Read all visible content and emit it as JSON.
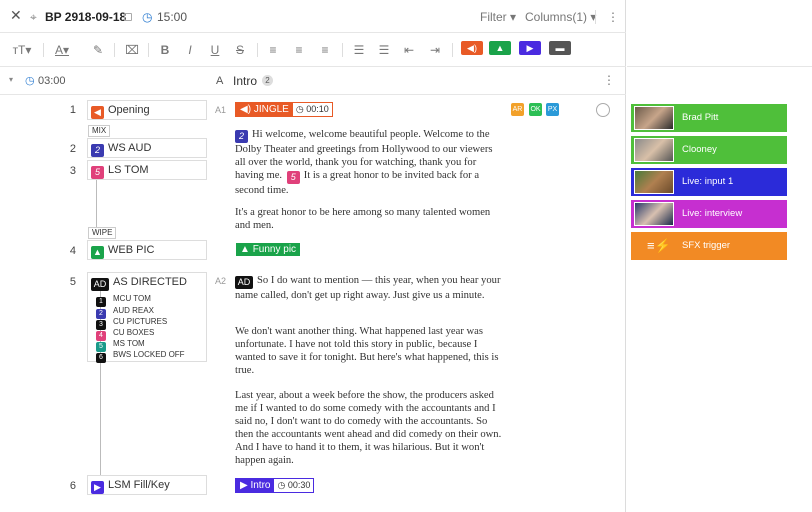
{
  "header": {
    "title": "BP 2918-09-18",
    "time": "15:00",
    "filter_label": "Filter",
    "columns_label": "Columns(1)"
  },
  "toolbar": {
    "buttons": [
      {
        "name": "text-size",
        "color": "#777"
      },
      {
        "name": "text-color",
        "color": "#777"
      },
      {
        "name": "highlight",
        "color": "#777"
      },
      {
        "name": "clear-format",
        "color": "#777"
      }
    ],
    "media_colors": {
      "audio": "#e85a26",
      "image": "#1aa34a",
      "video": "#4a2be0",
      "camera": "#555555"
    }
  },
  "segment": {
    "duration": "03:00",
    "column": "A",
    "name": "Intro",
    "count": "2"
  },
  "cues": {
    "r1": {
      "num": "1",
      "label": "Opening"
    },
    "mix": "MIX",
    "r2": {
      "num": "2",
      "label": "WS AUD",
      "icon_num": "2"
    },
    "r3": {
      "num": "3",
      "label": "LS TOM",
      "icon_num": "5"
    },
    "wipe": "WIPE",
    "r4": {
      "num": "4",
      "label": "WEB PIC"
    },
    "r5": {
      "num": "5",
      "label": "AS DIRECTED",
      "tag": "AD"
    },
    "subs": [
      {
        "n": "1",
        "label": "MCU TOM",
        "color": "#111"
      },
      {
        "n": "2",
        "label": "AUD REAX",
        "color": "#3a3ab0"
      },
      {
        "n": "3",
        "label": "CU PICTURES",
        "color": "#111"
      },
      {
        "n": "4",
        "label": "CU BOXES",
        "color": "#e0407a"
      },
      {
        "n": "5",
        "label": "MS TOM",
        "color": "#1b9a8a"
      },
      {
        "n": "6",
        "label": "BWS LOCKED OFF",
        "color": "#111"
      }
    ],
    "r6": {
      "num": "6",
      "label": "LSM Fill/Key"
    }
  },
  "script": {
    "a1": "A1",
    "a2": "A2",
    "jingle": "JINGLE",
    "jingle_time": "00:10",
    "badges": [
      "AR",
      "OK",
      "PX"
    ],
    "p1_num": "2",
    "p1": "Hi welcome, welcome beautiful people. Welcome to the Dolby Theater and greetings from Hollywood to our viewers all over the world, thank you for watching, thank you for having me.",
    "p1_num2": "5",
    "p1b": "It is a great honor to be invited back for a second time.",
    "p2": "It's a great honor to be here among so many talented women and men.",
    "funny": "Funny pic",
    "ad": "AD",
    "p3": "So I do want to mention — this year, when you hear your name called, don't get up right away. Just give us a minute.",
    "p4": "We don't want another thing. What happened last year was unfortunate. I have not told this story in public, because I wanted to save it for tonight. But here's what happened, this is true.",
    "p5": "Last year, about a week before the show, the producers asked me if I wanted to do some comedy with the accountants and I said no, I don't want to do comedy with the accountants. So then the accountants went ahead and did comedy on their own. And I have to hand it to them, it was hilarious. But it won't happen again.",
    "intro": "Intro",
    "intro_time": "00:30"
  },
  "sources": [
    {
      "label": "Brad Pitt",
      "color": "#4fbf3a"
    },
    {
      "label": "Clooney",
      "color": "#4fbf3a"
    },
    {
      "label": "Live: input 1",
      "color": "#2b2bd9"
    },
    {
      "label": "Live: interview",
      "color": "#c62fd0"
    },
    {
      "label": "SFX trigger",
      "color": "#f28a24"
    }
  ]
}
